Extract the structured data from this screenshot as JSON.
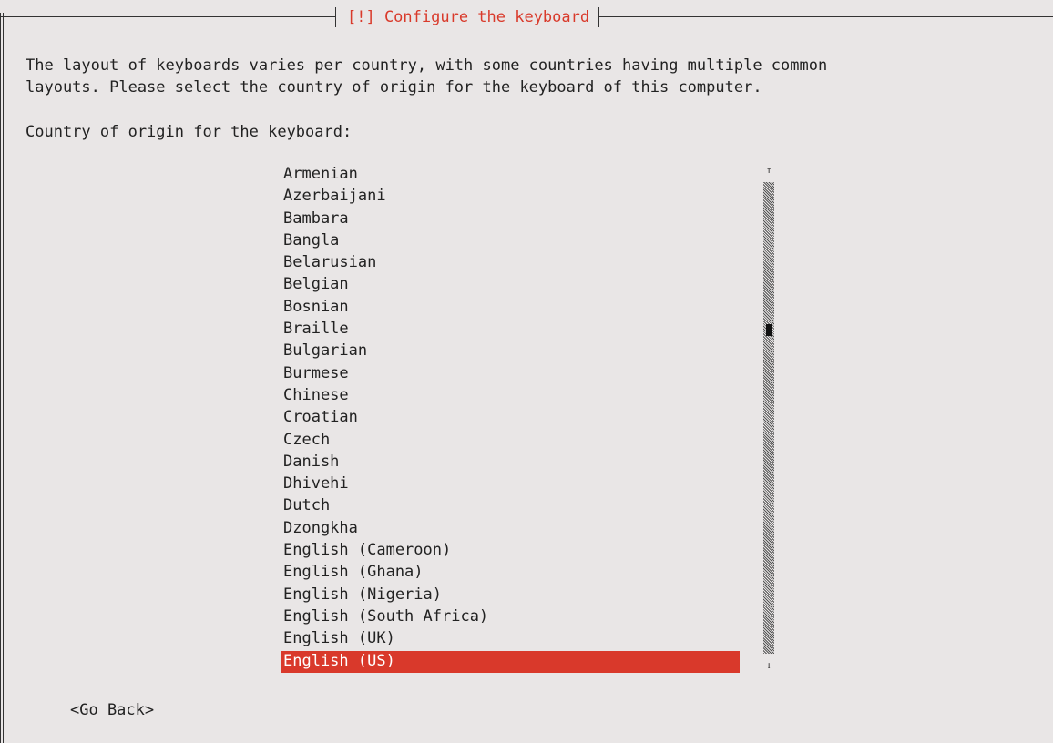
{
  "dialog": {
    "title": "[!] Configure the keyboard",
    "description_lines": [
      "The layout of keyboards varies per country, with some countries having multiple common",
      "layouts. Please select the country of origin for the keyboard of this computer."
    ],
    "prompt": "Country of origin for the keyboard:"
  },
  "list": {
    "items": [
      "Armenian",
      "Azerbaijani",
      "Bambara",
      "Bangla",
      "Belarusian",
      "Belgian",
      "Bosnian",
      "Braille",
      "Bulgarian",
      "Burmese",
      "Chinese",
      "Croatian",
      "Czech",
      "Danish",
      "Dhivehi",
      "Dutch",
      "Dzongkha",
      "English (Cameroon)",
      "English (Ghana)",
      "English (Nigeria)",
      "English (South Africa)",
      "English (UK)",
      "English (US)"
    ],
    "selected_index": 22,
    "selected_color": "#d9392b",
    "scroll_up_glyph": "↑",
    "scroll_down_glyph": "↓"
  },
  "buttons": {
    "go_back": "<Go Back>"
  },
  "colors": {
    "background": "#e9e6e6",
    "title": "#d93a2b",
    "text": "#222222"
  }
}
